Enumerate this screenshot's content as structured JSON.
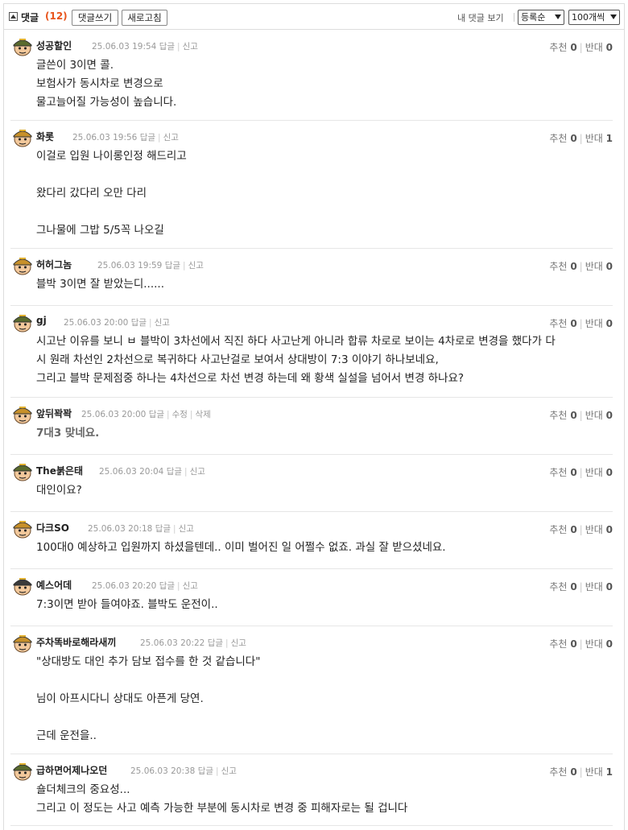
{
  "header": {
    "title": "댓글",
    "count": "(12)",
    "write_label": "댓글쓰기",
    "refresh_label": "새로고침",
    "my_comments_label": "내 댓글 보기",
    "sort_value": "등록순",
    "per_page_value": "100개씩"
  },
  "labels": {
    "reply": "답글",
    "report": "신고",
    "edit": "수정",
    "delete": "삭제",
    "up": "추천",
    "down": "반대"
  },
  "comments": [
    {
      "nick": "성공할인",
      "date": "25.06.03 19:54",
      "up": "0",
      "down": "0",
      "own": false,
      "text": "글쓴이 3이면 콜.\n보험사가 동시차로 변경으로\n물고늘어질 가능성이 높습니다."
    },
    {
      "nick": "화롯",
      "date": "25.06.03 19:56",
      "up": "0",
      "down": "1",
      "own": false,
      "text": "이걸로 입원 나이롱인정 해드리고\n\n왔다리 갔다리 오만 다리\n\n그나물에 그밥 5/5꼭 나오길"
    },
    {
      "nick": "허허그놈",
      "date": "25.06.03 19:59",
      "up": "0",
      "down": "0",
      "own": false,
      "text": "블박 3이면 잘 받았는디......"
    },
    {
      "nick": "gj",
      "date": "25.06.03 20:00",
      "up": "0",
      "down": "0",
      "own": false,
      "text": "시고난 이유를 보니 ㅂ 블박이 3차선에서 직진 하다 사고난게 아니라 합류 차로로 보이는 4차로로 변경을 했다가 다\n시 원래 차선인 2차선으로 복귀하다 사고난걸로 보여서 상대방이 7:3 이야기 하나보네요,\n그리고 블박 문제점중 하나는 4차선으로 차선 변경 하는데 왜 황색 실설을 넘어서 변경 하나요?"
    },
    {
      "nick": "앞뒤꽉꽉",
      "date": "25.06.03 20:00",
      "up": "0",
      "down": "0",
      "own": true,
      "text": "7대3 맞네요."
    },
    {
      "nick": "The붉은태",
      "date": "25.06.03 20:04",
      "up": "0",
      "down": "0",
      "own": false,
      "text": "대인이요?"
    },
    {
      "nick": "다크SO",
      "date": "25.06.03 20:18",
      "up": "0",
      "down": "0",
      "own": false,
      "text": "100대0 예상하고 입원까지 하셨을텐데.. 이미 벌어진 일 어쩔수 없죠. 과실 잘 받으셨네요."
    },
    {
      "nick": "예스어데",
      "date": "25.06.03 20:20",
      "up": "0",
      "down": "0",
      "own": false,
      "text": "7:3이면 받아 들여야죠. 블박도 운전이.."
    },
    {
      "nick": "주차똑바로해라새끼",
      "date": "25.06.03 20:22",
      "up": "0",
      "down": "0",
      "own": false,
      "text": "\"상대방도 대인 추가 담보 접수를 한 것 같습니다\"\n\n님이 아프시다니 상대도 아픈게 당연.\n\n근데 운전을.."
    },
    {
      "nick": "급하면어제나오던",
      "date": "25.06.03 20:38",
      "up": "0",
      "down": "1",
      "own": false,
      "text": "숄더체크의 중요성...\n그리고 이 정도는 사고 예측 가능한 부분에 동시차로 변경 중 피해자로는 될 겁니다"
    }
  ],
  "colors": {
    "accent": "#e8541c",
    "border": "#dddddd",
    "text": "#222222",
    "meta": "#999999"
  }
}
